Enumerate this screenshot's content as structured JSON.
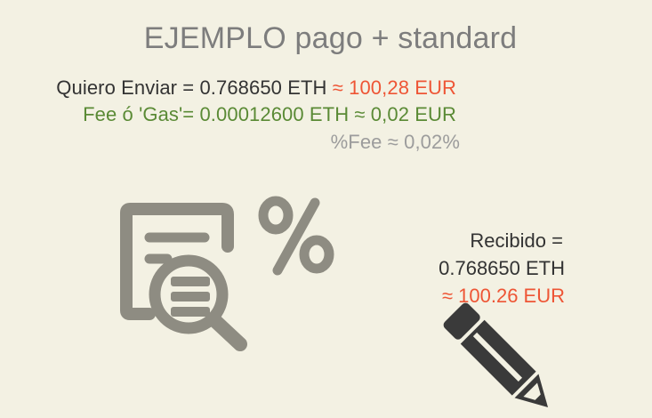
{
  "title": "EJEMPLO pago + standard",
  "send": {
    "text": "Quiero Enviar = 0.768650 ETH",
    "approx": "≈ 100,28 EUR"
  },
  "fee": {
    "text": "Fee ó 'Gas'= 0.00012600 ETH ≈ 0,02 EUR"
  },
  "fee_percent": {
    "text": "%Fee ≈ 0,02%"
  },
  "received": {
    "label": "Recibido =",
    "eth": "0.768650 ETH",
    "eur": "≈ 100.26 EUR"
  },
  "icons": {
    "document": "document-search-icon",
    "percent": "percent-icon",
    "pencil": "pencil-icon"
  },
  "colors": {
    "background": "#f3f1e3",
    "red": "#ee5535",
    "green": "#5a8a35",
    "gray_icon": "#8e8c82",
    "dark_icon": "#3a3a3a"
  }
}
